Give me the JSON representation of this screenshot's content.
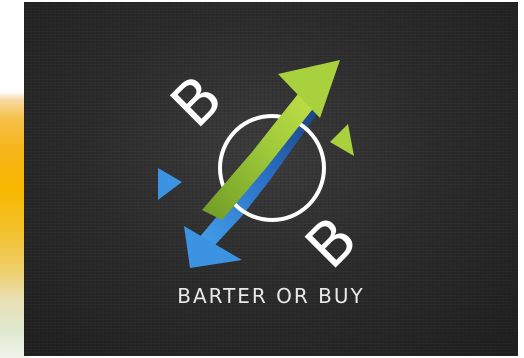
{
  "logo": {
    "letter_top": "B",
    "letter_bottom": "B",
    "tagline": "BARTER OR BUY",
    "colors": {
      "background": "#2b2b2b",
      "green": "#9fca3a",
      "blue": "#2f7fd6",
      "white": "#ffffff"
    }
  }
}
